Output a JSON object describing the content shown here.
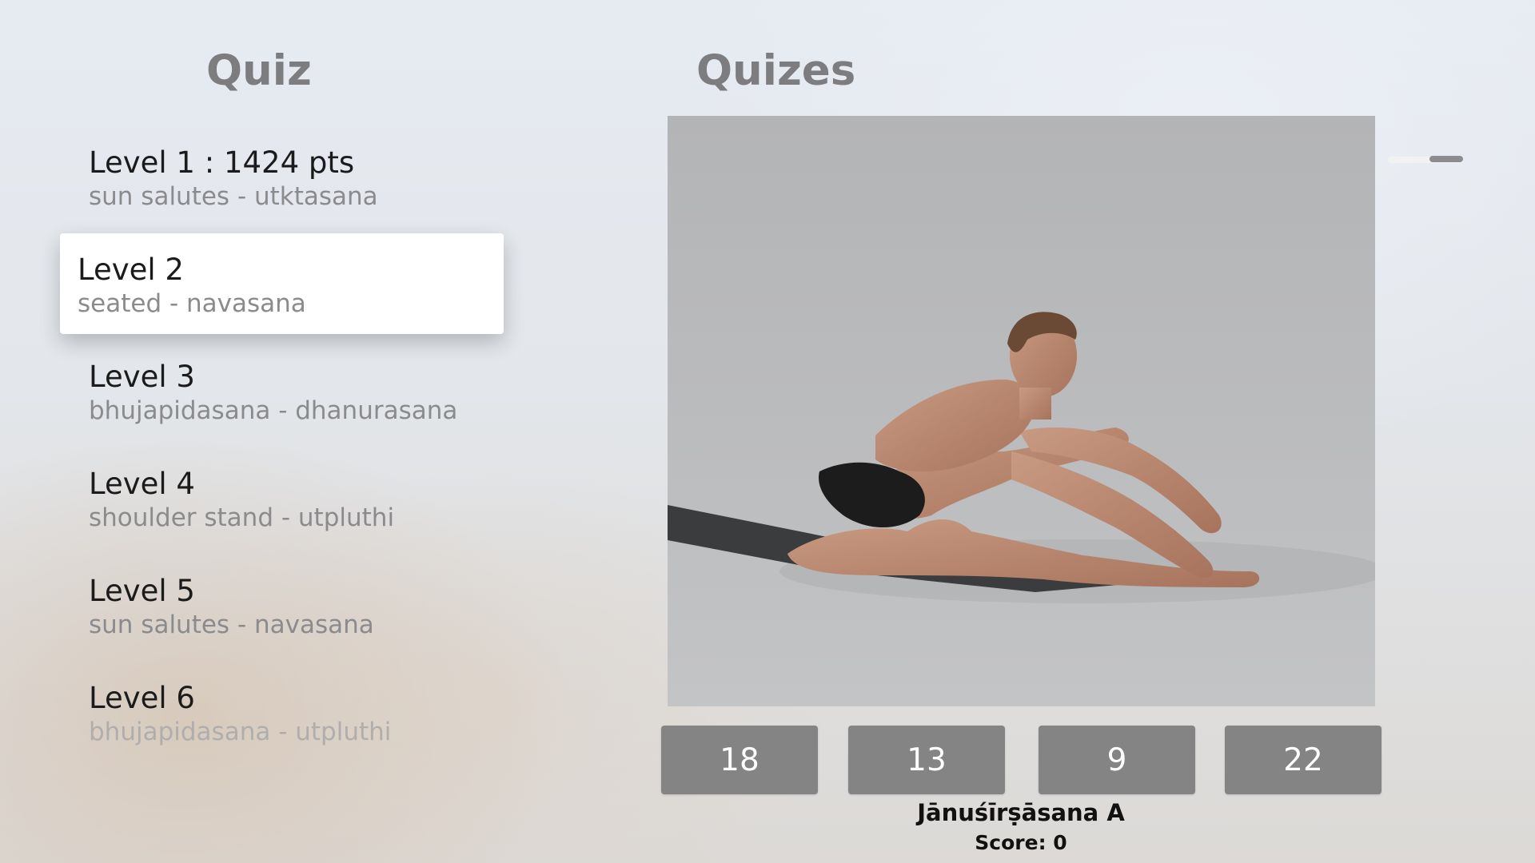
{
  "left_panel": {
    "title": "Quiz",
    "levels": [
      {
        "title": "Level 1 : 1424 pts",
        "subtitle": "sun salutes - utktasana"
      },
      {
        "title": "Level 2",
        "subtitle": "seated - navasana"
      },
      {
        "title": "Level 3",
        "subtitle": "bhujapidasana - dhanurasana"
      },
      {
        "title": "Level 4",
        "subtitle": "shoulder stand - utpluthi"
      },
      {
        "title": "Level 5",
        "subtitle": "sun salutes - navasana"
      },
      {
        "title": "Level 6",
        "subtitle": "bhujapidasana - utpluthi"
      }
    ],
    "focused_index": 1
  },
  "right_panel": {
    "title": "Quizes",
    "answers": [
      "18",
      "13",
      "9",
      "22"
    ],
    "pose_name": "Jānuśīrṣāsana A",
    "score": "Score: 0"
  },
  "colors": {
    "heading": "#7d7d80",
    "answer_button": "#848484",
    "focused_item": "#ffffff"
  }
}
